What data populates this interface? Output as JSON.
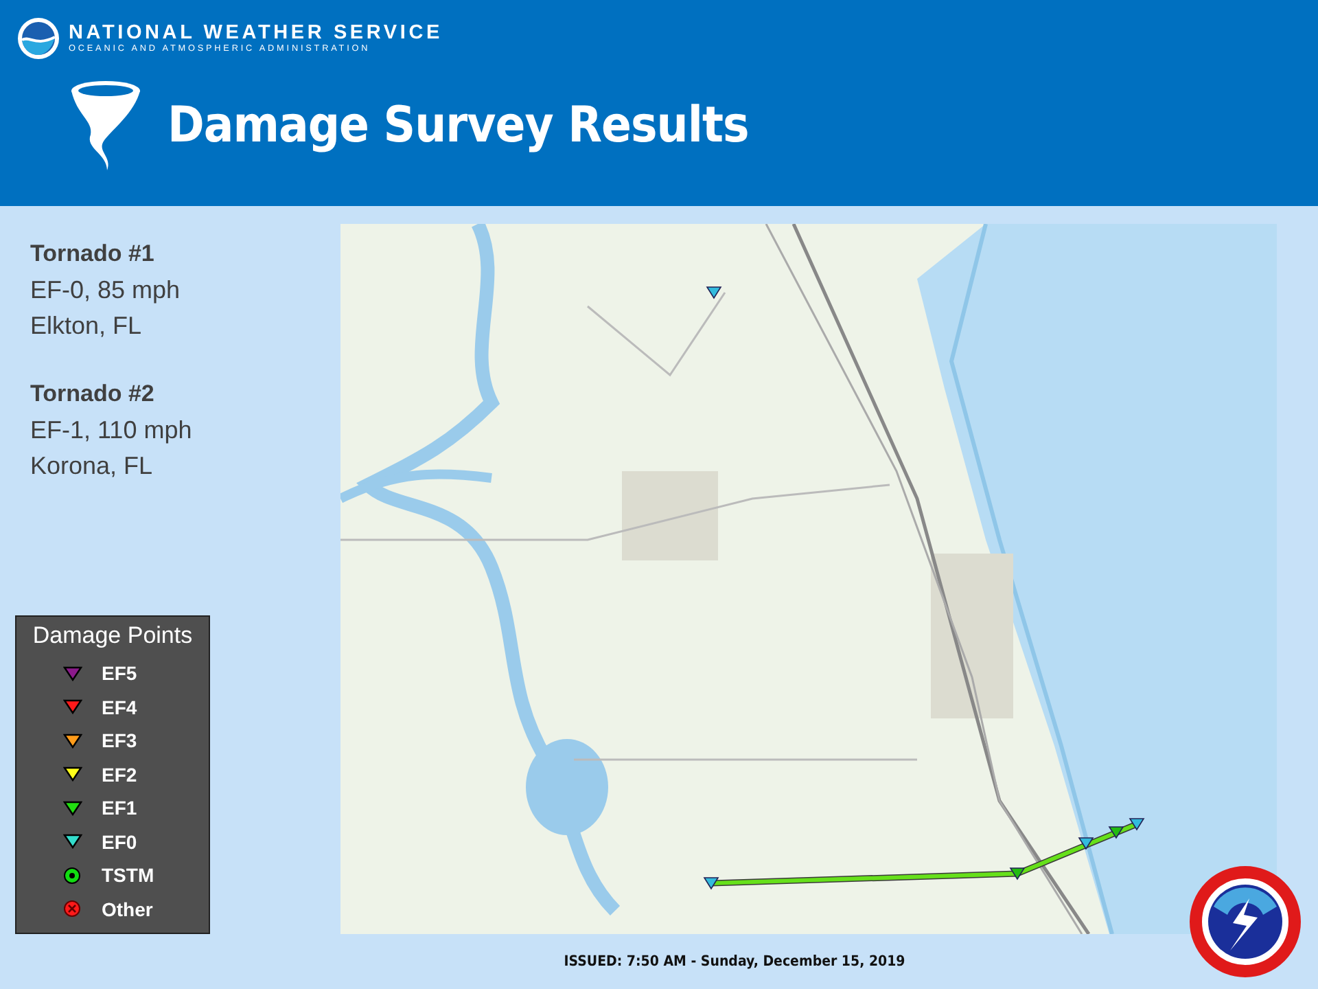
{
  "header": {
    "agency": "NATIONAL WEATHER SERVICE",
    "sub_agency": "OCEANIC AND ATMOSPHERIC ADMINISTRATION",
    "title": "Damage Survey Results"
  },
  "tornadoes": [
    {
      "title": "Tornado #1",
      "rating": "EF-0, 85 mph",
      "place": "Elkton, FL"
    },
    {
      "title": "Tornado #2",
      "rating": "EF-1, 110 mph",
      "place": "Korona, FL"
    }
  ],
  "legend": {
    "title": "Damage Points",
    "items": [
      {
        "label": "EF5",
        "kind": "triangle",
        "color": "#8b1a8b"
      },
      {
        "label": "EF4",
        "kind": "triangle",
        "color": "#ff1a1a"
      },
      {
        "label": "EF3",
        "kind": "triangle",
        "color": "#ff9c1a"
      },
      {
        "label": "EF2",
        "kind": "triangle",
        "color": "#ffff1a"
      },
      {
        "label": "EF1",
        "kind": "triangle",
        "color": "#22dd11"
      },
      {
        "label": "EF0",
        "kind": "triangle",
        "color": "#33ddcc"
      },
      {
        "label": "TSTM",
        "kind": "ring",
        "color": "#11dd11"
      },
      {
        "label": "Other",
        "kind": "cross",
        "color": "#ff1a1a"
      }
    ]
  },
  "footer": {
    "issued": "ISSUED: 7:50 AM - Sunday, December 15, 2019"
  }
}
